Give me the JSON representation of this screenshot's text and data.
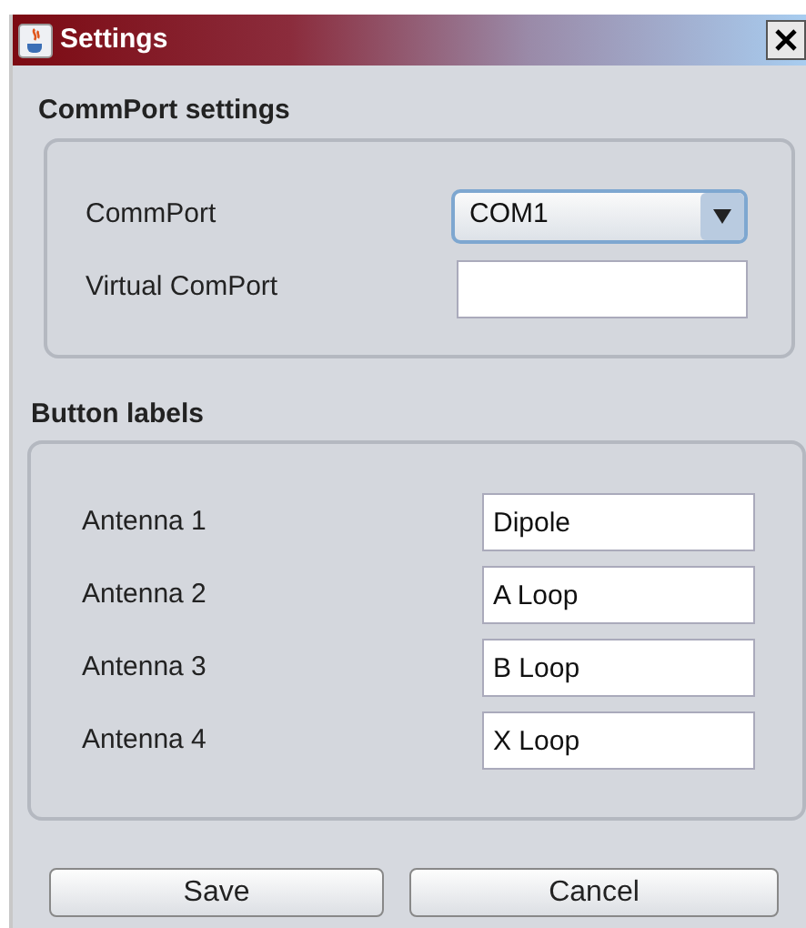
{
  "window": {
    "title": "Settings"
  },
  "commport_settings": {
    "title": "CommPort settings",
    "fields": [
      {
        "label": "CommPort",
        "kind": "combo",
        "value": "COM1"
      },
      {
        "label": "Virtual ComPort",
        "kind": "text"
      }
    ]
  },
  "button_labels": {
    "title": "Button labels",
    "fields": [
      {
        "label": "Antenna 1",
        "value": "Dipole"
      },
      {
        "label": "Antenna 2",
        "value": "A Loop"
      },
      {
        "label": "Antenna 3",
        "value": "B Loop"
      },
      {
        "label": "Antenna 4",
        "value": "X Loop"
      }
    ]
  },
  "buttons": [
    "Save",
    "Cancel"
  ]
}
